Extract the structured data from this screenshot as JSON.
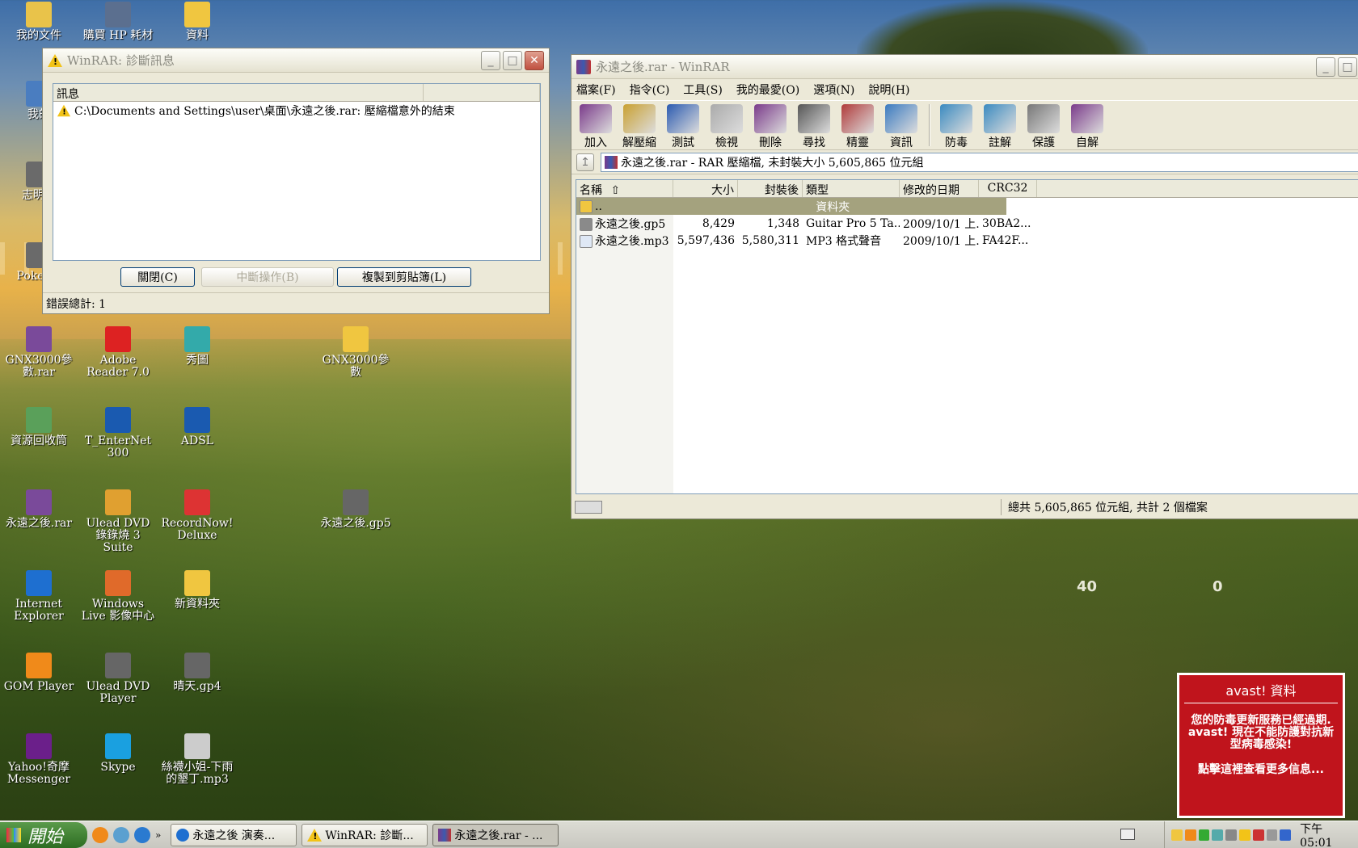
{
  "desktop": {
    "icons": [
      {
        "label": "我的文件",
        "color": "#e9c34a"
      },
      {
        "label": "購買 HP 耗材",
        "color": "#5b6f8f"
      },
      {
        "label": "資料",
        "color": "#f0c640"
      },
      {
        "label": "我的",
        "color": "#4a7dc0"
      },
      {
        "label": "志明與",
        "color": "#6a6a6a"
      },
      {
        "label": "Poker F",
        "color": "#6a6a6a"
      },
      {
        "label": "GNX3000參數.rar",
        "color": "#7a4a9a"
      },
      {
        "label": "Adobe Reader 7.0",
        "color": "#d22"
      },
      {
        "label": "秀圖",
        "color": "#3aa"
      },
      {
        "label": "GNX3000參數",
        "color": "#f0c640"
      },
      {
        "label": "資源回收筒",
        "color": "#5aa05a"
      },
      {
        "label": "T_EnterNet 300",
        "color": "#1a5ab0"
      },
      {
        "label": "ADSL",
        "color": "#1a5ab0"
      },
      {
        "label": "永遠之後.rar",
        "color": "#7a4a9a"
      },
      {
        "label": "Ulead DVD 錄錄燒 3 Suite",
        "color": "#e0a030"
      },
      {
        "label": "RecordNow! Deluxe",
        "color": "#d33"
      },
      {
        "label": "永遠之後.gp5",
        "color": "#666"
      },
      {
        "label": "Internet Explorer",
        "color": "#1e6fd0"
      },
      {
        "label": "Windows Live 影像中心",
        "color": "#e06a2a"
      },
      {
        "label": "新資料夾",
        "color": "#f0c640"
      },
      {
        "label": "GOM Player",
        "color": "#f08a1a"
      },
      {
        "label": "Ulead DVD Player",
        "color": "#666"
      },
      {
        "label": "晴天.gp4",
        "color": "#666"
      },
      {
        "label": "Yahoo!奇摩 Messenger",
        "color": "#6b1f8a"
      },
      {
        "label": "Skype",
        "color": "#1aa0e0"
      },
      {
        "label": "絲襪小姐-下雨的墾丁.mp3",
        "color": "#ccc"
      }
    ],
    "bg_numbers": [
      "40",
      "0"
    ]
  },
  "diag": {
    "title": "WinRAR: 診斷訊息",
    "col_header": "訊息",
    "message": "C:\\Documents and Settings\\user\\桌面\\永遠之後.rar: 壓縮檔意外的結束",
    "btn_close": "關閉(C)",
    "btn_abort": "中斷操作(B)",
    "btn_copy": "複製到剪貼簿(L)",
    "status": "錯誤總計: 1"
  },
  "winrar": {
    "title": "永遠之後.rar - WinRAR",
    "menus": [
      "檔案(F)",
      "指令(C)",
      "工具(S)",
      "我的最愛(O)",
      "選項(N)",
      "說明(H)"
    ],
    "tools": [
      {
        "label": "加入",
        "icon": "add-icon"
      },
      {
        "label": "解壓縮到",
        "icon": "extract-icon"
      },
      {
        "label": "測試",
        "icon": "test-icon"
      },
      {
        "label": "檢視",
        "icon": "view-icon"
      },
      {
        "label": "刪除",
        "icon": "delete-icon"
      },
      {
        "label": "尋找",
        "icon": "find-icon"
      },
      {
        "label": "精靈",
        "icon": "wizard-icon"
      },
      {
        "label": "資訊",
        "icon": "info-icon"
      },
      {
        "label": "防毒",
        "icon": "virusscan-icon"
      },
      {
        "label": "註解",
        "icon": "comment-icon"
      },
      {
        "label": "保護",
        "icon": "protect-icon"
      },
      {
        "label": "自解",
        "icon": "sfx-icon"
      }
    ],
    "address": "永遠之後.rar - RAR 壓縮檔, 未封裝大小 5,605,865 位元組",
    "columns": [
      "名稱",
      "大小",
      "封裝後",
      "類型",
      "修改的日期",
      "CRC32"
    ],
    "rows": [
      {
        "name": "..",
        "size": "",
        "packed": "",
        "type": "資料夾",
        "date": "",
        "crc": ""
      },
      {
        "name": "永遠之後.gp5",
        "size": "8,429",
        "packed": "1,348",
        "type": "Guitar Pro 5 Ta...",
        "date": "2009/10/1 上...",
        "crc": "30BA2..."
      },
      {
        "name": "永遠之後.mp3",
        "size": "5,597,436",
        "packed": "5,580,311",
        "type": "MP3 格式聲音",
        "date": "2009/10/1 上...",
        "crc": "FA42F..."
      }
    ],
    "status": "總共 5,605,865 位元組, 共計 2 個檔案"
  },
  "taskbar": {
    "start": "開始",
    "tasks": [
      "永遠之後 演奏...",
      "WinRAR: 診斷...",
      "永遠之後.rar - ..."
    ],
    "clock": "下午 05:01"
  },
  "avast": {
    "title": "avast! 資料",
    "body": "您的防毒更新服務已經過期. avast! 現在不能防護對抗新型病毒感染!",
    "link": "點擊這裡查看更多信息..."
  }
}
